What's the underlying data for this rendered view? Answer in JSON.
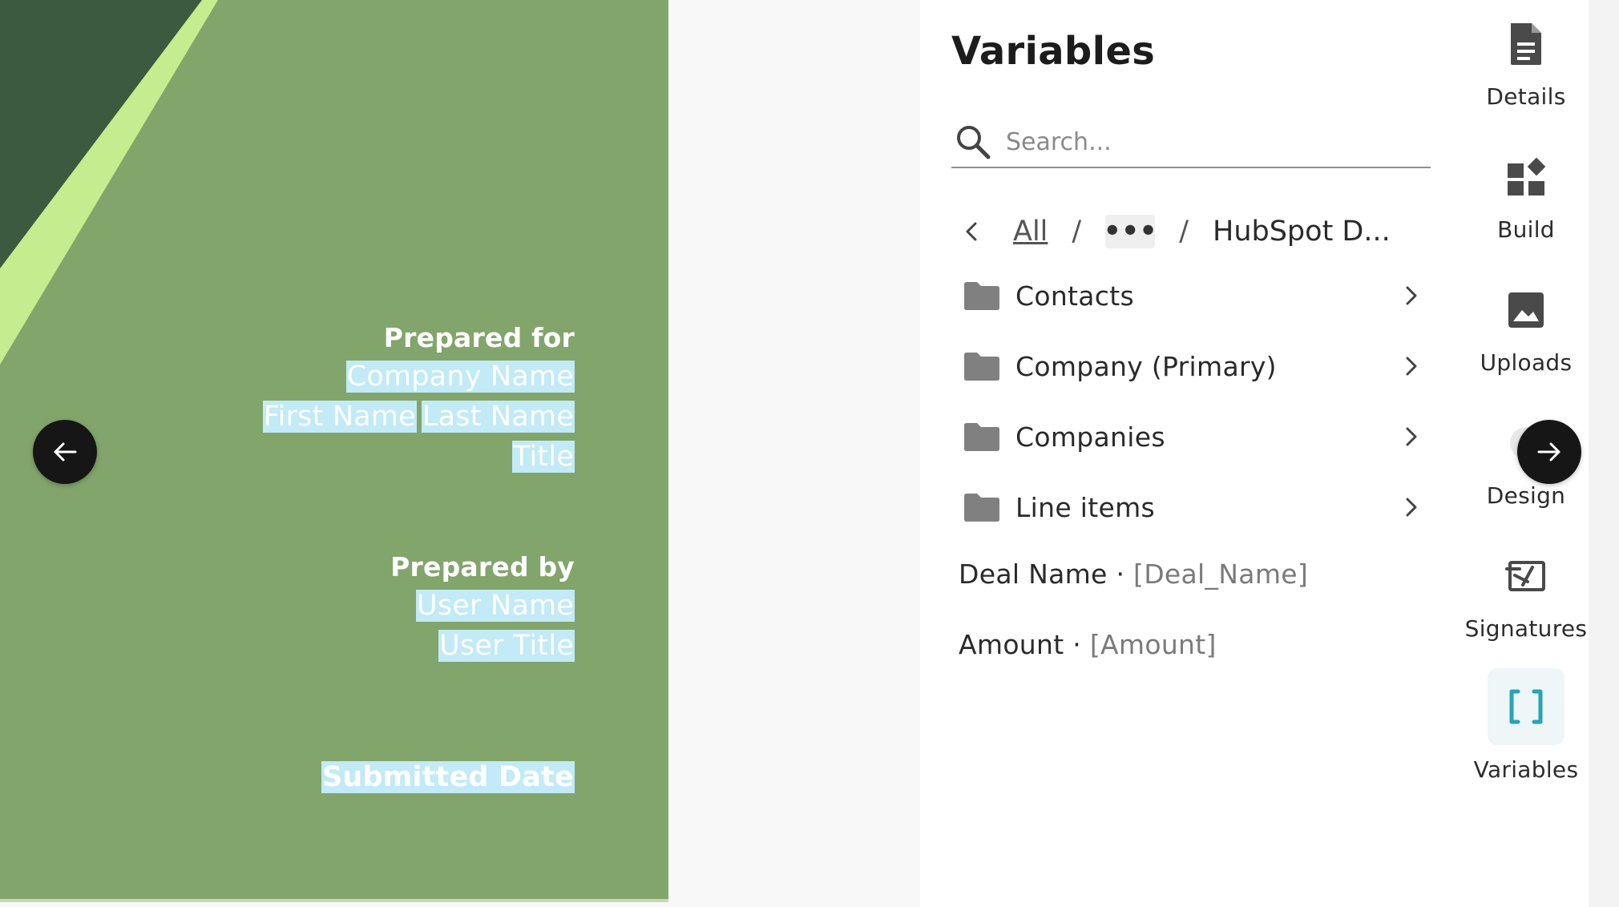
{
  "document": {
    "prepared_for": {
      "heading": "Prepared for",
      "company_name": "Company Name",
      "first_name": "First Name",
      "last_name": "Last Name",
      "title": "Title"
    },
    "prepared_by": {
      "heading": "Prepared by",
      "user_name": "User Name",
      "user_title": "User Title"
    },
    "submitted_date": "Submitted Date"
  },
  "nav": {
    "prev_icon": "arrow-left-icon",
    "next_icon": "arrow-right-icon"
  },
  "panel": {
    "title": "Variables",
    "search": {
      "placeholder": "Search...",
      "value": ""
    },
    "breadcrumb": {
      "all": "All",
      "separator": "/",
      "more": "•••",
      "current": "HubSpot D..."
    },
    "folders": [
      {
        "label": "Contacts"
      },
      {
        "label": "Company (Primary)"
      },
      {
        "label": "Companies"
      },
      {
        "label": "Line items"
      }
    ],
    "fields": [
      {
        "label": "Deal Name",
        "sep": " · ",
        "token": "[Deal_Name]"
      },
      {
        "label": "Amount",
        "sep": " · ",
        "token": "[Amount]"
      }
    ]
  },
  "sidebar": {
    "items": [
      {
        "label": "Details",
        "icon": "document-icon"
      },
      {
        "label": "Build",
        "icon": "blocks-icon"
      },
      {
        "label": "Uploads",
        "icon": "image-icon"
      },
      {
        "label": "Design",
        "icon": "palette-icon"
      },
      {
        "label": "Signatures",
        "icon": "signature-icon"
      },
      {
        "label": "Variables",
        "icon": "brackets-icon",
        "active": true
      }
    ]
  },
  "colors": {
    "doc_bg": "#82a56b",
    "doc_dark": "#3b5a40",
    "doc_light": "#c5ec8e",
    "highlight": "#c2eaf7",
    "accent": "#29a3b8"
  }
}
